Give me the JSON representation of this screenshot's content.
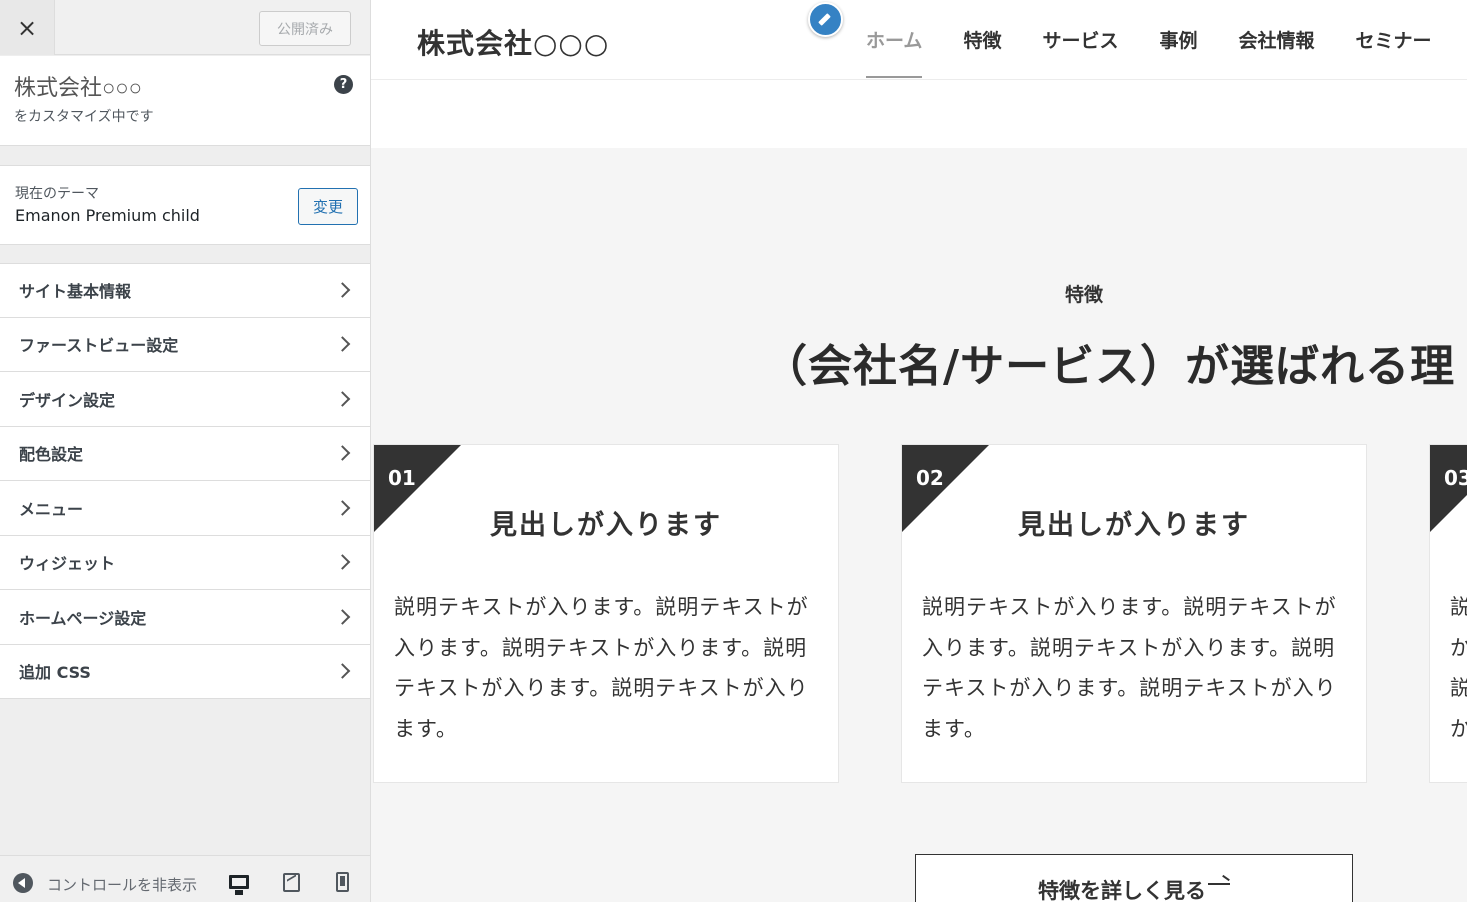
{
  "customizer": {
    "close_label": "×",
    "publish_label": "公開済み",
    "site_name": "株式会社○○○",
    "customizing_label": "をカスタマイズ中です",
    "help_label": "?",
    "theme_label": "現在のテーマ",
    "theme_name": "Emanon Premium child",
    "change_label": "変更",
    "menu": [
      {
        "label": "サイト基本情報"
      },
      {
        "label": "ファーストビュー設定"
      },
      {
        "label": "デザイン設定"
      },
      {
        "label": "配色設定"
      },
      {
        "label": "メニュー"
      },
      {
        "label": "ウィジェット"
      },
      {
        "label": "ホームページ設定"
      },
      {
        "label": "追加 CSS"
      }
    ],
    "footer": {
      "collapse_label": "コントロールを非表示"
    }
  },
  "preview": {
    "logo": "株式会社○○○",
    "nav": [
      "ホーム",
      "特徴",
      "サービス",
      "事例",
      "会社情報",
      "セミナー"
    ],
    "section": {
      "kicker": "特徴",
      "heading": "（会社名/サービス）が選ばれる理"
    },
    "cards": [
      {
        "num": "01",
        "title": "見出しが入ります",
        "body": "説明テキストが入ります。説明テキストが入ります。説明テキストが入ります。説明テキストが入ります。説明テキストが入ります。"
      },
      {
        "num": "02",
        "title": "見出しが入ります",
        "body": "説明テキストが入ります。説明テキストが入ります。説明テキストが入ります。説明テキストが入ります。説明テキストが入ります。"
      },
      {
        "num": "03",
        "title": "",
        "body": "説か説か"
      }
    ],
    "more_label": "特徴を詳しく見る"
  },
  "colors": {
    "accent": "#2271b1",
    "edit_shortcut": "#3582c4",
    "card_badge": "#333333"
  }
}
